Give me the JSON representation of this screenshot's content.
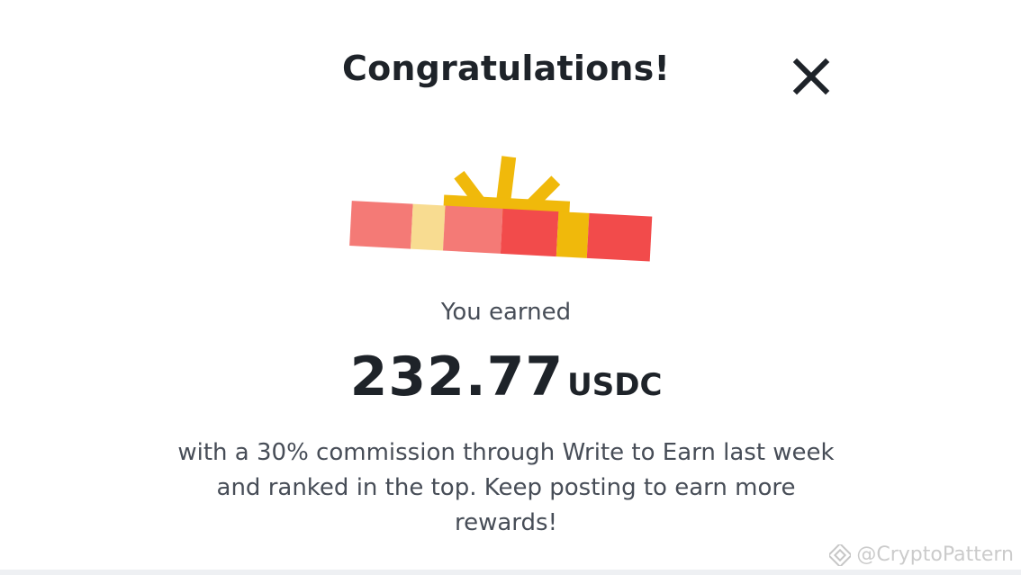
{
  "dialog": {
    "title": "Congratulations!",
    "close_icon": "close-icon",
    "illustration_icon": "gift-box-icon",
    "earned_label": "You earned",
    "amount": "232.77",
    "currency": "USDC",
    "description": "with a 30% commission through Write to Earn last week and ranked in the top. Keep posting to earn more rewards!"
  },
  "watermark": {
    "icon": "binance-logo-icon",
    "text": "@CryptoPattern"
  },
  "colors": {
    "title_text": "#1e2329",
    "body_text": "#474d57",
    "gift_red": "#f24b4b",
    "gift_pink": "#f47a76",
    "gift_yellow": "#f0b90b",
    "gift_light_yellow": "#f8dc91"
  }
}
